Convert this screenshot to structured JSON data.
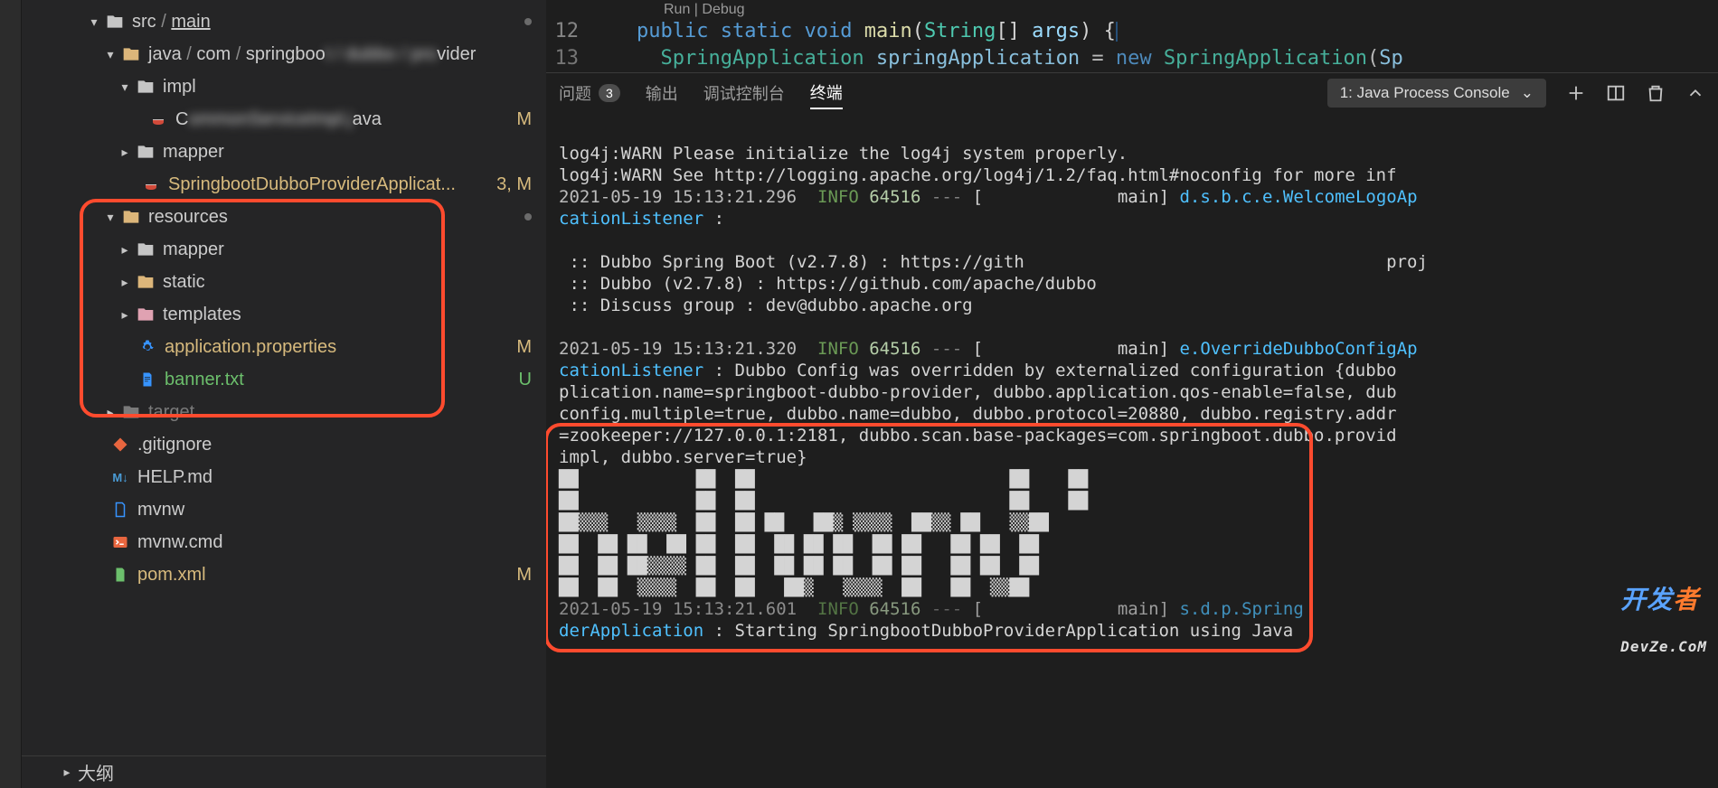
{
  "sidebar": {
    "breadcrumbsSrc": "src",
    "breadcrumbsMain": "main",
    "javaPathPrefix": "java",
    "javaPathMid1": "com",
    "javaPathMid2": "springboo",
    "javaPathSuffix": "vider",
    "items": {
      "impl": "impl",
      "c_java": "C",
      "c_java_suffix": "ava",
      "mapper1": "mapper",
      "spring_app": "SpringbootDubboProviderApplicat...",
      "spring_app_status": "3, M",
      "resources": "resources",
      "mapper2": "mapper",
      "static": "static",
      "templates": "templates",
      "app_props": "application.properties",
      "banner": "banner.txt",
      "target": "target",
      "gitignore": ".gitignore",
      "help": "HELP.md",
      "mvnw": "mvnw",
      "mvnw_cmd": "mvnw.cmd",
      "pom": "pom.xml",
      "status_M": "M",
      "status_U": "U"
    },
    "outline": "大纲"
  },
  "editor": {
    "codelens": "Run | Debug",
    "line12_num": "12",
    "line13_num": "13",
    "kw_public": "public",
    "kw_static": "static",
    "kw_void": "void",
    "fn_main": "main",
    "type_string": "String",
    "var_args": "args",
    "type_sa": "SpringApplication",
    "var_sa": "springApplication",
    "kw_new": "new",
    "ctor_sa": "SpringApplication",
    "ctor_arg": "Sp"
  },
  "panel": {
    "tabs": {
      "problems": "问题",
      "problems_badge": "3",
      "output": "输出",
      "debug": "调试控制台",
      "terminal": "终端"
    },
    "dropdown": "1: Java Process Console"
  },
  "terminal": {
    "l1": "log4j:WARN Please initialize the log4j system properly.",
    "l2": "log4j:WARN See http://logging.apache.org/log4j/1.2/faq.html#noconfig for more inf",
    "ts1": "2021-05-19 15:13:21.296",
    "info": "INFO",
    "pid": "64516",
    "dashes": "---",
    "bracket_open": "[",
    "thread": "main]",
    "class1": "d.s.b.c.e.WelcomeLogoAp",
    "cat_listener": "cationListener",
    "colon_blank": " :",
    "dubbo1": " :: Dubbo Spring Boot (v2.7.8) : https://gith                                   proj",
    "dubbo2": " :: Dubbo (v2.7.8) : https://github.com/apache/dubbo",
    "dubbo3": " :: Discuss group : dev@dubbo.apache.org",
    "ts2": "2021-05-19 15:13:21.320",
    "class2": "e.OverrideDubboConfigAp",
    "cfg1": " : Dubbo Config was overridden by externalized configuration {dubbo",
    "cfg2": "plication.name=springboot-dubbo-provider, dubbo.application.qos-enable=false, dub",
    "cfg3": "config.multiple=true, dubbo.name=dubbo, dubbo.protocol=20880, dubbo.registry.addr",
    "cfg4": "=zookeeper://127.0.0.1:2181, dubbo.scan.base-packages=com.springboot.dubbo.provid",
    "cfg5": "impl, dubbo.server=true}",
    "ts3": "2021-05-19 15:13:21.601",
    "class3": "s.d.p.Spring",
    "der_app": "derApplication",
    "starting": " : Starting SpringbootDubboProviderApplication using Java",
    "ascii1": "██            ██  ██                          ██    ██",
    "ascii2": "██            ██  ██                          ██    ██",
    "ascii3": "██▒▒▒   ▒▒▒▒  ██  ██ ██   ██▒ ▒▒▒▒  ██▒▒ ██   ▒▒██",
    "ascii4": "██  ██ ██  ██ ██  ██  ██ ██ ██  ██ ██   ██ ██  ██",
    "ascii5": "██  ██ ██▒▒▒▒ ██  ██  ██ ██ ██  ██ ██   ██ ██  ██",
    "ascii6": "██  ██  ▒▒▒▒  ██  ██   ██▒   ▒▒▒▒  ██   ██  ▒▒██",
    "watermark_a": "开发",
    "watermark_b": "者",
    "watermark_c": "DevZe.CoM"
  }
}
